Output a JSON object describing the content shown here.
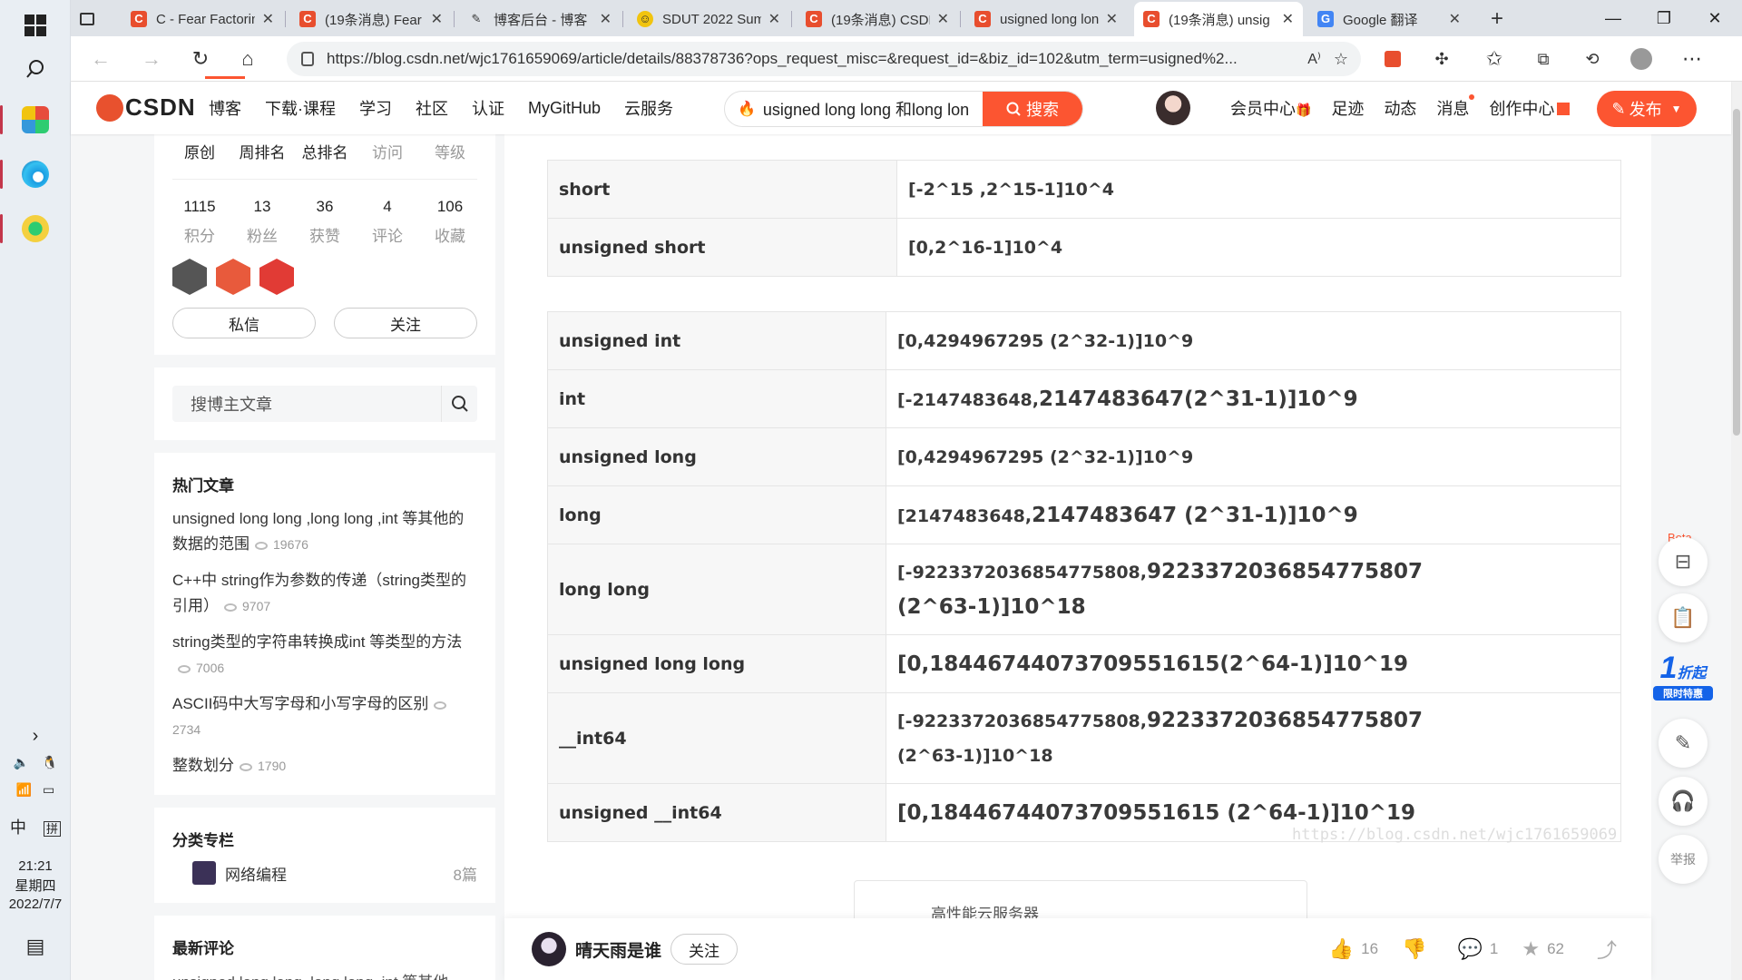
{
  "os": {
    "tray": {
      "time": "21:21",
      "weekday": "星期四",
      "date": "2022/7/7",
      "ime_lang": "中",
      "ime_mode": "拼"
    }
  },
  "browser": {
    "tabs": [
      {
        "label": "C - Fear Factoring"
      },
      {
        "label": "(19条消息) Fear"
      },
      {
        "label": "博客后台 - 博客"
      },
      {
        "label": "SDUT 2022 Sum"
      },
      {
        "label": "(19条消息) CSDN"
      },
      {
        "label": "usigned long lon"
      },
      {
        "label": "(19条消息) unsig"
      },
      {
        "label": "Google 翻译"
      }
    ],
    "active_tab": 6,
    "url": "https://blog.csdn.net/wjc1761659069/article/details/88378736?ops_request_misc=&request_id=&biz_id=102&utm_term=usigned%2..."
  },
  "csdn": {
    "logo": "CSDN",
    "nav": [
      "博客",
      "下载·课程",
      "学习",
      "社区",
      "认证",
      "MyGitHub",
      "云服务"
    ],
    "search": {
      "query": "usigned long long 和long lon",
      "button": "搜索"
    },
    "right_nav": [
      "会员中心",
      "足迹",
      "动态",
      "消息",
      "创作中心"
    ],
    "publish": "发布"
  },
  "sidebar": {
    "stats_head": [
      "原创",
      "周排名",
      "总排名",
      "访问",
      "等级"
    ],
    "stats_values": [
      "1115",
      "13",
      "36",
      "4",
      "106"
    ],
    "stats_labels": [
      "积分",
      "粉丝",
      "获赞",
      "评论",
      "收藏"
    ],
    "btn_message": "私信",
    "btn_follow": "关注",
    "search_placeholder": "搜博主文章",
    "hot_title": "热门文章",
    "hot": [
      {
        "title": "unsigned long long ,long long ,int 等其他的数据的范围",
        "views": "19676"
      },
      {
        "title": "C++中 string作为参数的传递（string类型的引用）",
        "views": "9707"
      },
      {
        "title": "string类型的字符串转换成int 等类型的方法",
        "views": "7006"
      },
      {
        "title": "ASCII码中大写字母和小写字母的区别",
        "views": "2734"
      },
      {
        "title": "整数划分",
        "views": "1790"
      }
    ],
    "category_title": "分类专栏",
    "category": {
      "name": "网络编程",
      "count": "8篇"
    },
    "comments_title": "最新评论",
    "comment_preview": "unsigned long long ,long long ,int 等其他..."
  },
  "article": {
    "table1": [
      {
        "type": "short",
        "range": "[-2^15 ,2^15-1]10^4"
      },
      {
        "type": "unsigned short",
        "range": "[0,2^16-1]10^4"
      }
    ],
    "table2": [
      {
        "type": "unsigned int",
        "range": "[0,4294967295 (2^32-1)]10^9"
      },
      {
        "type": "int",
        "range_a": "[-2147483648,",
        "range_b": "2147483647(2^31-1)]10^9"
      },
      {
        "type": "unsigned long",
        "range": "[0,4294967295 (2^32-1)]10^9"
      },
      {
        "type": "long",
        "range_a": "[2147483648,",
        "range_b": "2147483647  (2^31-1)]10^9"
      },
      {
        "type": "long long",
        "range_a": "[-9223372036854775808,",
        "range_b": "9223372036854775807",
        "range_c": "(2^63-1)]10^18"
      },
      {
        "type": "unsigned long long",
        "range_a": "[0,",
        "range_b": "18446744073709551615(2^64-1)]10^19"
      },
      {
        "type": "__int64",
        "range_a": "[-9223372036854775808,",
        "range_b": "9223372036854775807",
        "range_c": "(2^63-1)]10^18"
      },
      {
        "type": "unsigned __int64",
        "range_a": "[0,",
        "range_b": "18446744073709551615 (2^64-1)]10^19"
      }
    ],
    "watermark": "https://blog.csdn.net/wjc1761659069",
    "ad_text": "高性能云服务器"
  },
  "bottom": {
    "author": "晴天雨是谁",
    "follow": "关注",
    "likes": "16",
    "comments": "1",
    "favorites": "62"
  },
  "tools": {
    "beta": "Beta",
    "discount_num": "1",
    "discount_label": "折起",
    "discount_sub": "限时特惠",
    "report": "举报"
  },
  "colors": {
    "accent": "#fc5531",
    "discount": "#1463e8"
  }
}
